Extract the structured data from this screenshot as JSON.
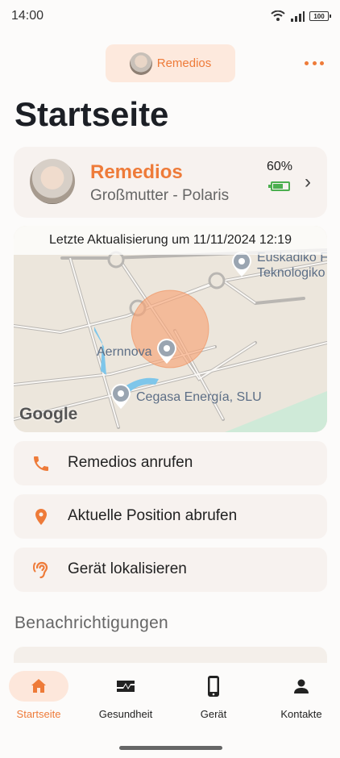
{
  "status_bar": {
    "time": "14:00",
    "battery": "100"
  },
  "header": {
    "profile_name": "Remedios"
  },
  "page": {
    "title": "Startseite"
  },
  "person_card": {
    "name": "Remedios",
    "role": "Großmutter - Polaris",
    "battery_percent": "60%"
  },
  "map": {
    "last_update": "Letzte Aktualisierung um 11/11/2024 12:19",
    "labels": {
      "place1": "Euskadiko F",
      "place1_line2": "Teknologiko",
      "place2": "Aernnova",
      "place3": "Cegasa Energía, SLU"
    },
    "attribution": "Google"
  },
  "actions": [
    {
      "label": "Remedios anrufen",
      "icon": "phone-icon"
    },
    {
      "label": "Aktuelle Position abrufen",
      "icon": "location-pin-icon"
    },
    {
      "label": "Gerät lokalisieren",
      "icon": "ear-icon"
    }
  ],
  "notifications": {
    "title": "Benachrichtigungen"
  },
  "bottom_nav": [
    {
      "label": "Startseite",
      "icon": "home-icon",
      "active": true
    },
    {
      "label": "Gesundheit",
      "icon": "health-icon",
      "active": false
    },
    {
      "label": "Gerät",
      "icon": "device-icon",
      "active": false
    },
    {
      "label": "Kontakte",
      "icon": "contact-icon",
      "active": false
    }
  ],
  "colors": {
    "accent": "#ee7b39",
    "card": "#f7f2ef",
    "battery_green": "#4caf50"
  }
}
